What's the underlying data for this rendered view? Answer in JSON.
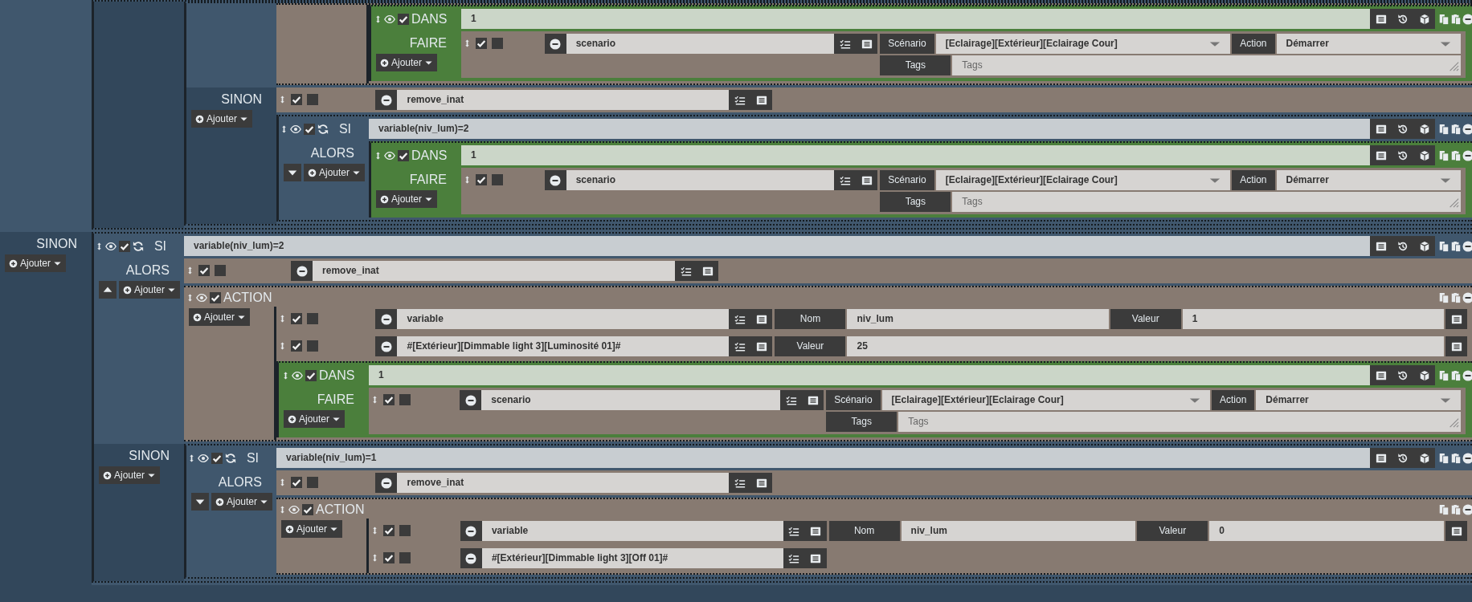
{
  "root": {
    "kind": "si",
    "alors": {
      "children": [
        {
          "kind": "si",
          "sinon": {
            "children": [
              {
                "kind": "si",
                "alors": {
                  "children": [
                    {
                      "kind": "action",
                      "children": [
                        {
                          "kind": "dans",
                          "title": "DANS",
                          "enabled": true,
                          "value": "1",
                          "faire": {
                            "label": "FAIRE",
                            "add_button": "Ajouter",
                            "children": [
                              {
                                "kind": "expression",
                                "enabled": true,
                                "background": false,
                                "command": "scenario",
                                "params": [
                                  {
                                    "kind": "select",
                                    "label": "Scénario",
                                    "value": "[Eclairage][Extérieur][Eclairage Cour]"
                                  },
                                  {
                                    "kind": "select",
                                    "label": "Action",
                                    "value": "Démarrer"
                                  }
                                ],
                                "tags": {
                                  "label": "Tags",
                                  "placeholder": "Tags"
                                }
                              }
                            ]
                          }
                        }
                      ]
                    }
                  ]
                },
                "sinon": {
                  "label": "SINON",
                  "add_button": "Ajouter",
                  "children": [
                    {
                      "kind": "expression",
                      "enabled": true,
                      "background": false,
                      "command": "remove_inat"
                    },
                    {
                      "kind": "si",
                      "title": "SI",
                      "enabled": true,
                      "condition": "variable(niv_lum)=2",
                      "alors": {
                        "label": "ALORS",
                        "expanded": false,
                        "add_button": "Ajouter",
                        "children": [
                          {
                            "kind": "dans",
                            "title": "DANS",
                            "enabled": true,
                            "value": "1",
                            "faire": {
                              "label": "FAIRE",
                              "add_button": "Ajouter",
                              "children": [
                                {
                                  "kind": "expression",
                                  "enabled": true,
                                  "background": false,
                                  "command": "scenario",
                                  "params": [
                                    {
                                      "kind": "select",
                                      "label": "Scénario",
                                      "value": "[Eclairage][Extérieur][Eclairage Cour]"
                                    },
                                    {
                                      "kind": "select",
                                      "label": "Action",
                                      "value": "Démarrer"
                                    }
                                  ],
                                  "tags": {
                                    "label": "Tags",
                                    "placeholder": "Tags"
                                  }
                                }
                              ]
                            }
                          }
                        ]
                      }
                    }
                  ]
                }
              }
            ]
          }
        }
      ]
    },
    "sinon": {
      "label": "SINON",
      "add_button": "Ajouter",
      "children": [
        {
          "kind": "si",
          "title": "SI",
          "enabled": true,
          "condition": "variable(niv_lum)=2",
          "alors": {
            "label": "ALORS",
            "expanded": true,
            "add_button": "Ajouter",
            "children": [
              {
                "kind": "expression",
                "enabled": true,
                "background": false,
                "command": "remove_inat"
              },
              {
                "kind": "action",
                "title": "ACTION",
                "enabled": true,
                "add_button": "Ajouter",
                "children": [
                  {
                    "kind": "expression",
                    "enabled": true,
                    "background": false,
                    "command": "variable",
                    "params": [
                      {
                        "kind": "text",
                        "label": "Nom",
                        "value": "niv_lum"
                      },
                      {
                        "kind": "text",
                        "label": "Valeur",
                        "value": "1"
                      }
                    ],
                    "options_button": true
                  },
                  {
                    "kind": "expression",
                    "enabled": true,
                    "background": false,
                    "command": "#[Extérieur][Dimmable light 3][Luminosité 01]#",
                    "params": [
                      {
                        "kind": "text",
                        "label": "Valeur",
                        "value": "25"
                      }
                    ],
                    "options_button": true
                  },
                  {
                    "kind": "dans",
                    "title": "DANS",
                    "enabled": true,
                    "value": "1",
                    "faire": {
                      "label": "FAIRE",
                      "add_button": "Ajouter",
                      "children": [
                        {
                          "kind": "expression",
                          "enabled": true,
                          "background": false,
                          "command": "scenario",
                          "params": [
                            {
                              "kind": "select",
                              "label": "Scénario",
                              "value": "[Eclairage][Extérieur][Eclairage Cour]"
                            },
                            {
                              "kind": "select",
                              "label": "Action",
                              "value": "Démarrer"
                            }
                          ],
                          "tags": {
                            "label": "Tags",
                            "placeholder": "Tags"
                          }
                        }
                      ]
                    }
                  }
                ]
              }
            ]
          },
          "sinon": {
            "label": "SINON",
            "add_button": "Ajouter",
            "children": [
              {
                "kind": "si",
                "title": "SI",
                "enabled": true,
                "condition": "variable(niv_lum)=1",
                "alors": {
                  "label": "ALORS",
                  "expanded": false,
                  "add_button": "Ajouter",
                  "children": [
                    {
                      "kind": "expression",
                      "enabled": true,
                      "background": false,
                      "command": "remove_inat"
                    },
                    {
                      "kind": "action",
                      "title": "ACTION",
                      "enabled": true,
                      "add_button": "Ajouter",
                      "children": [
                        {
                          "kind": "expression",
                          "enabled": true,
                          "background": false,
                          "command": "variable",
                          "params": [
                            {
                              "kind": "text",
                              "label": "Nom",
                              "value": "niv_lum"
                            },
                            {
                              "kind": "text",
                              "label": "Valeur",
                              "value": "0"
                            }
                          ],
                          "options_button": true
                        },
                        {
                          "kind": "expression",
                          "enabled": true,
                          "background": false,
                          "command": "#[Extérieur][Dimmable light 3][Off 01]#"
                        }
                      ]
                    }
                  ]
                }
              }
            ]
          }
        }
      ]
    }
  }
}
